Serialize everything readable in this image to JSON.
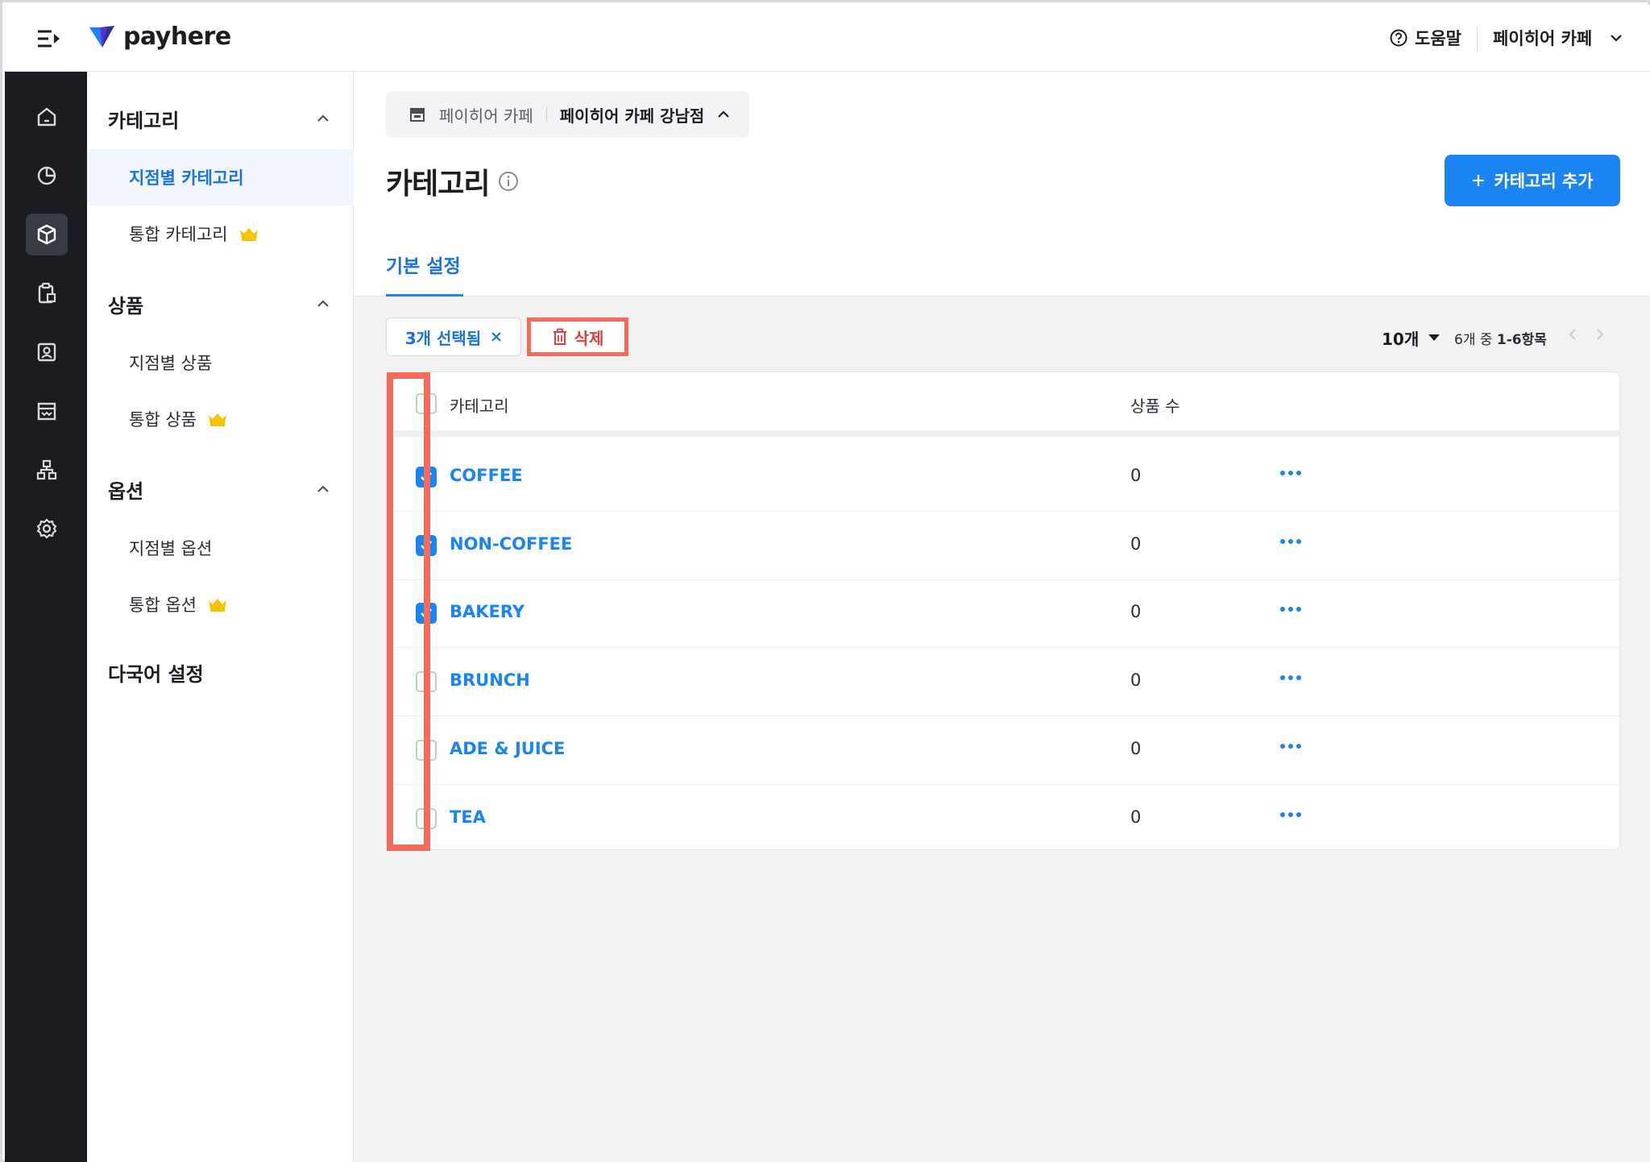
{
  "header": {
    "logo_text": "payhere",
    "help_label": "도움말",
    "store_name": "페이히어 카페"
  },
  "rail": {
    "items": [
      {
        "icon": "home-icon"
      },
      {
        "icon": "chart-pie-icon"
      },
      {
        "icon": "box-icon",
        "active": true
      },
      {
        "icon": "clipboard-icon"
      },
      {
        "icon": "contact-card-icon"
      },
      {
        "icon": "store-icon"
      },
      {
        "icon": "org-chart-icon"
      },
      {
        "icon": "gear-icon"
      }
    ]
  },
  "subnav": {
    "sections": [
      {
        "title": "카테고리",
        "items": [
          {
            "label": "지점별 카테고리",
            "active": true
          },
          {
            "label": "통합 카테고리",
            "premium": true
          }
        ]
      },
      {
        "title": "상품",
        "items": [
          {
            "label": "지점별 상품"
          },
          {
            "label": "통합 상품",
            "premium": true
          }
        ]
      },
      {
        "title": "옵션",
        "items": [
          {
            "label": "지점별 옵션"
          },
          {
            "label": "통합 옵션",
            "premium": true
          }
        ]
      }
    ],
    "extra": "다국어 설정"
  },
  "breadcrumb": {
    "store": "페이히어 카페",
    "branch": "페이히어 카페 강남점"
  },
  "page": {
    "title": "카테고리",
    "add_button": "카테고리 추가",
    "tab": "기본 설정"
  },
  "toolbar": {
    "selected_label": "3개 선택됨",
    "delete_label": "삭제",
    "page_size": "10개",
    "range_prefix": "6개 중",
    "range_value": "1-6항목"
  },
  "table": {
    "columns": [
      "카테고리",
      "상품 수"
    ],
    "rows": [
      {
        "name": "COFFEE",
        "count": "0",
        "checked": true
      },
      {
        "name": "NON-COFFEE",
        "count": "0",
        "checked": true
      },
      {
        "name": "BAKERY",
        "count": "0",
        "checked": true
      },
      {
        "name": "BRUNCH",
        "count": "0",
        "checked": false
      },
      {
        "name": "ADE & JUICE",
        "count": "0",
        "checked": false
      },
      {
        "name": "TEA",
        "count": "0",
        "checked": false
      }
    ]
  },
  "colors": {
    "primary": "#1a84f2",
    "highlight": "#f26b5b",
    "rail_bg": "#1b1c21",
    "premium": "#f5c400"
  }
}
